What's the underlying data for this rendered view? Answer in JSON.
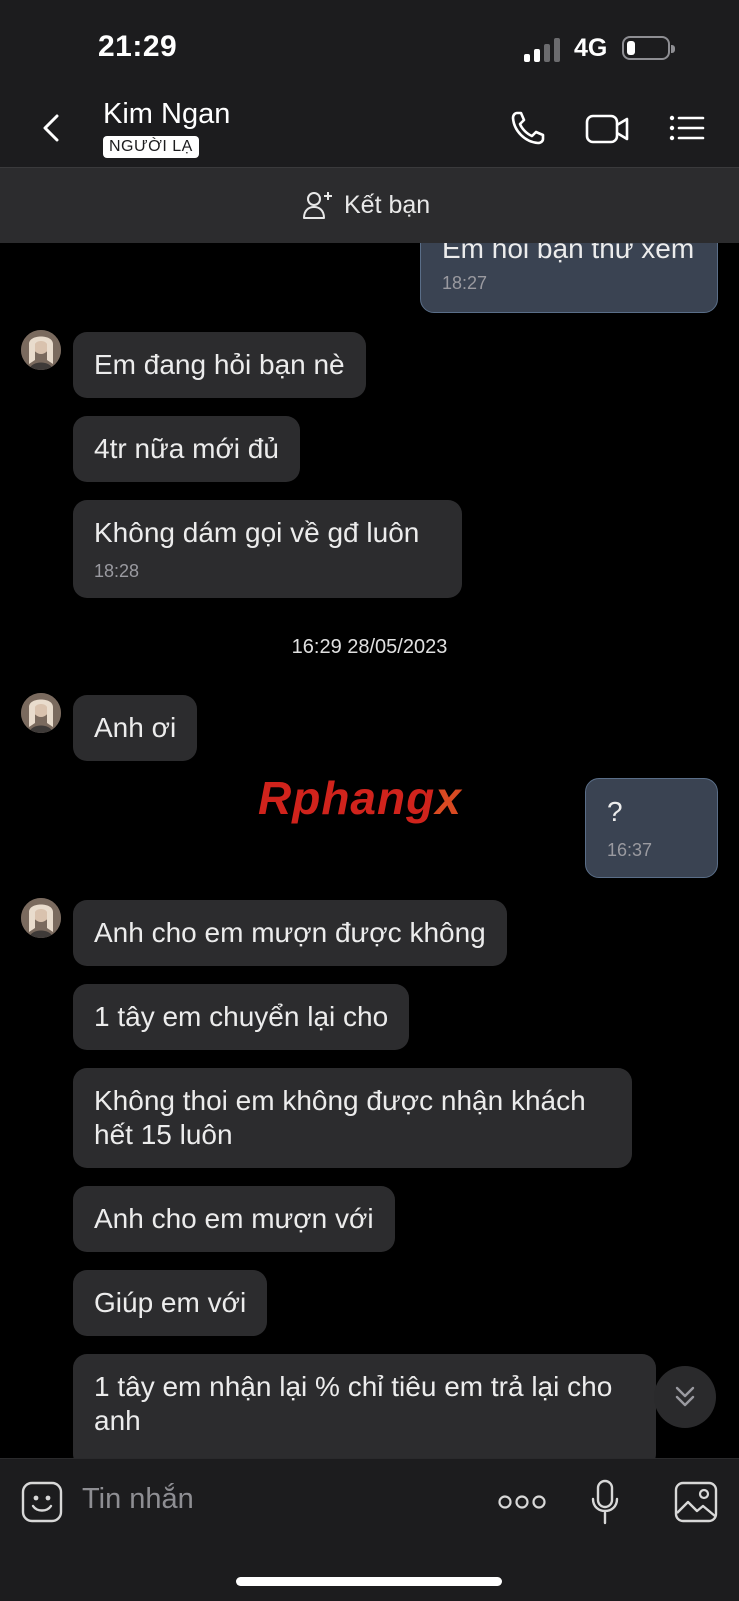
{
  "status_bar": {
    "time": "21:29",
    "network": "4G"
  },
  "header": {
    "contact_name": "Kim Ngan",
    "badge": "NGƯỜI LẠ"
  },
  "friend_bar": {
    "label": "Kết bạn"
  },
  "messages": [
    {
      "text": "Em hỏi bạn thử xem",
      "time": "18:27"
    },
    {
      "text": "Em đang hỏi bạn nè"
    },
    {
      "text": "4tr nữa mới đủ"
    },
    {
      "text": "Không dám gọi về gđ luôn",
      "time": "18:28"
    },
    {
      "separator": "16:29 28/05/2023"
    },
    {
      "text": "Anh ơi"
    },
    {
      "text": "?",
      "time": "16:37"
    },
    {
      "text": "Anh cho em mượn được không"
    },
    {
      "text": "1 tây em chuyển lại cho"
    },
    {
      "text": "Không thoi em không được nhận khách hết 15 luôn"
    },
    {
      "text": "Anh cho em mượn với"
    },
    {
      "text": "Giúp em với"
    },
    {
      "text": "1 tây em nhận lại % chỉ tiêu em trả lại cho anh"
    }
  ],
  "watermark": {
    "part1": "Rphang",
    "part2": "x"
  },
  "composer": {
    "placeholder": "Tin nhắn"
  },
  "colors": {
    "my_bubble": "#3a4352",
    "their_bubble": "#2c2c2e",
    "bar": "#1c1c1e",
    "watermark_red": "#d0231c",
    "watermark_blue": "#1f6fd6"
  }
}
